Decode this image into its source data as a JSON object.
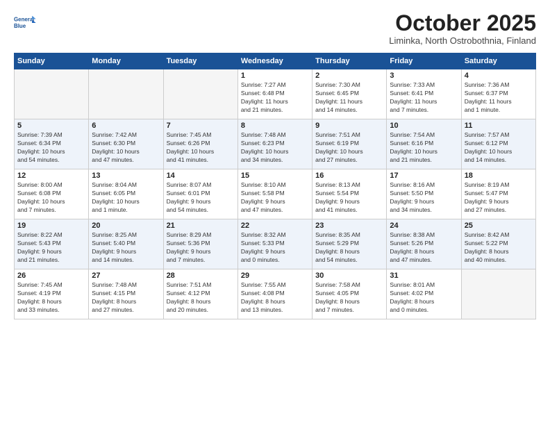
{
  "header": {
    "logo_line1": "General",
    "logo_line2": "Blue",
    "month": "October 2025",
    "location": "Liminka, North Ostrobothnia, Finland"
  },
  "days_of_week": [
    "Sunday",
    "Monday",
    "Tuesday",
    "Wednesday",
    "Thursday",
    "Friday",
    "Saturday"
  ],
  "weeks": [
    [
      {
        "day": "",
        "info": ""
      },
      {
        "day": "",
        "info": ""
      },
      {
        "day": "",
        "info": ""
      },
      {
        "day": "1",
        "info": "Sunrise: 7:27 AM\nSunset: 6:48 PM\nDaylight: 11 hours\nand 21 minutes."
      },
      {
        "day": "2",
        "info": "Sunrise: 7:30 AM\nSunset: 6:45 PM\nDaylight: 11 hours\nand 14 minutes."
      },
      {
        "day": "3",
        "info": "Sunrise: 7:33 AM\nSunset: 6:41 PM\nDaylight: 11 hours\nand 7 minutes."
      },
      {
        "day": "4",
        "info": "Sunrise: 7:36 AM\nSunset: 6:37 PM\nDaylight: 11 hours\nand 1 minute."
      }
    ],
    [
      {
        "day": "5",
        "info": "Sunrise: 7:39 AM\nSunset: 6:34 PM\nDaylight: 10 hours\nand 54 minutes."
      },
      {
        "day": "6",
        "info": "Sunrise: 7:42 AM\nSunset: 6:30 PM\nDaylight: 10 hours\nand 47 minutes."
      },
      {
        "day": "7",
        "info": "Sunrise: 7:45 AM\nSunset: 6:26 PM\nDaylight: 10 hours\nand 41 minutes."
      },
      {
        "day": "8",
        "info": "Sunrise: 7:48 AM\nSunset: 6:23 PM\nDaylight: 10 hours\nand 34 minutes."
      },
      {
        "day": "9",
        "info": "Sunrise: 7:51 AM\nSunset: 6:19 PM\nDaylight: 10 hours\nand 27 minutes."
      },
      {
        "day": "10",
        "info": "Sunrise: 7:54 AM\nSunset: 6:16 PM\nDaylight: 10 hours\nand 21 minutes."
      },
      {
        "day": "11",
        "info": "Sunrise: 7:57 AM\nSunset: 6:12 PM\nDaylight: 10 hours\nand 14 minutes."
      }
    ],
    [
      {
        "day": "12",
        "info": "Sunrise: 8:00 AM\nSunset: 6:08 PM\nDaylight: 10 hours\nand 7 minutes."
      },
      {
        "day": "13",
        "info": "Sunrise: 8:04 AM\nSunset: 6:05 PM\nDaylight: 10 hours\nand 1 minute."
      },
      {
        "day": "14",
        "info": "Sunrise: 8:07 AM\nSunset: 6:01 PM\nDaylight: 9 hours\nand 54 minutes."
      },
      {
        "day": "15",
        "info": "Sunrise: 8:10 AM\nSunset: 5:58 PM\nDaylight: 9 hours\nand 47 minutes."
      },
      {
        "day": "16",
        "info": "Sunrise: 8:13 AM\nSunset: 5:54 PM\nDaylight: 9 hours\nand 41 minutes."
      },
      {
        "day": "17",
        "info": "Sunrise: 8:16 AM\nSunset: 5:50 PM\nDaylight: 9 hours\nand 34 minutes."
      },
      {
        "day": "18",
        "info": "Sunrise: 8:19 AM\nSunset: 5:47 PM\nDaylight: 9 hours\nand 27 minutes."
      }
    ],
    [
      {
        "day": "19",
        "info": "Sunrise: 8:22 AM\nSunset: 5:43 PM\nDaylight: 9 hours\nand 21 minutes."
      },
      {
        "day": "20",
        "info": "Sunrise: 8:25 AM\nSunset: 5:40 PM\nDaylight: 9 hours\nand 14 minutes."
      },
      {
        "day": "21",
        "info": "Sunrise: 8:29 AM\nSunset: 5:36 PM\nDaylight: 9 hours\nand 7 minutes."
      },
      {
        "day": "22",
        "info": "Sunrise: 8:32 AM\nSunset: 5:33 PM\nDaylight: 9 hours\nand 0 minutes."
      },
      {
        "day": "23",
        "info": "Sunrise: 8:35 AM\nSunset: 5:29 PM\nDaylight: 8 hours\nand 54 minutes."
      },
      {
        "day": "24",
        "info": "Sunrise: 8:38 AM\nSunset: 5:26 PM\nDaylight: 8 hours\nand 47 minutes."
      },
      {
        "day": "25",
        "info": "Sunrise: 8:42 AM\nSunset: 5:22 PM\nDaylight: 8 hours\nand 40 minutes."
      }
    ],
    [
      {
        "day": "26",
        "info": "Sunrise: 7:45 AM\nSunset: 4:19 PM\nDaylight: 8 hours\nand 33 minutes."
      },
      {
        "day": "27",
        "info": "Sunrise: 7:48 AM\nSunset: 4:15 PM\nDaylight: 8 hours\nand 27 minutes."
      },
      {
        "day": "28",
        "info": "Sunrise: 7:51 AM\nSunset: 4:12 PM\nDaylight: 8 hours\nand 20 minutes."
      },
      {
        "day": "29",
        "info": "Sunrise: 7:55 AM\nSunset: 4:08 PM\nDaylight: 8 hours\nand 13 minutes."
      },
      {
        "day": "30",
        "info": "Sunrise: 7:58 AM\nSunset: 4:05 PM\nDaylight: 8 hours\nand 7 minutes."
      },
      {
        "day": "31",
        "info": "Sunrise: 8:01 AM\nSunset: 4:02 PM\nDaylight: 8 hours\nand 0 minutes."
      },
      {
        "day": "",
        "info": ""
      }
    ]
  ]
}
